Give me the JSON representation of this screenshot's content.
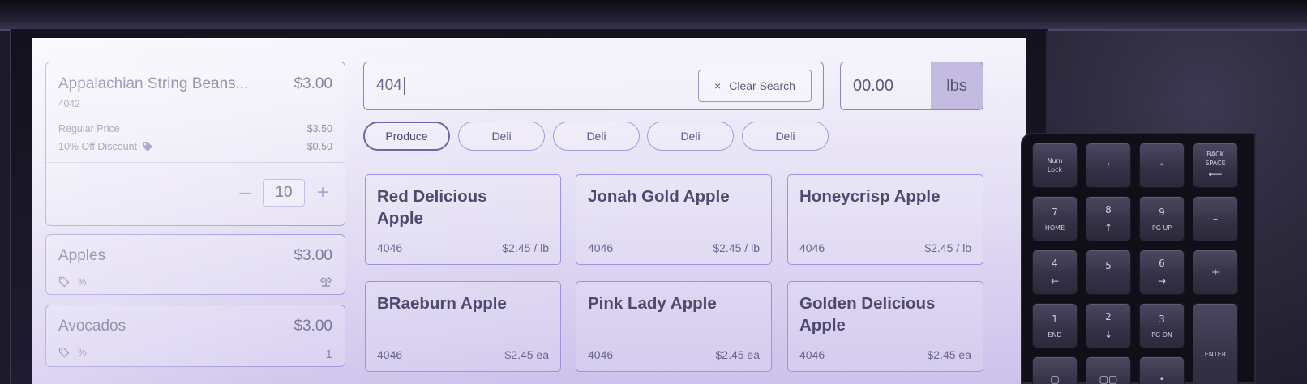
{
  "cart": {
    "items": [
      {
        "name": "Appalachian String Beans...",
        "price": "$3.00",
        "sku": "4042",
        "regular_label": "Regular Price",
        "regular_value": "$3.50",
        "discount_label": "10% Off Discount",
        "discount_value": "— $0.50",
        "qty": "10",
        "minus": "–",
        "plus": "+"
      },
      {
        "name": "Apples",
        "price": "$3.00"
      },
      {
        "name": "Avocados",
        "price": "$3.00",
        "qty": "1"
      }
    ],
    "pct_icon_text": "%"
  },
  "search": {
    "value": "404",
    "clear_label": "Clear Search",
    "clear_icon": "×"
  },
  "weight": {
    "value": "00.00",
    "unit": "lbs"
  },
  "categories": [
    "Produce",
    "Deli",
    "Deli",
    "Deli",
    "Deli"
  ],
  "products": [
    {
      "name": "Red Delicious Apple",
      "sku": "4046",
      "price": "$2.45 / lb"
    },
    {
      "name": "Jonah Gold Apple",
      "sku": "4046",
      "price": "$2.45 / lb"
    },
    {
      "name": "Honeycrisp Apple",
      "sku": "4046",
      "price": "$2.45 / lb"
    },
    {
      "name": "BRaeburn Apple",
      "sku": "4046",
      "price": "$2.45 ea"
    },
    {
      "name": "Pink Lady Apple",
      "sku": "4046",
      "price": "$2.45 ea"
    },
    {
      "name": "Golden Delicious Apple",
      "sku": "4046",
      "price": "$2.45 ea"
    }
  ],
  "keypad": {
    "numlock_1": "Num",
    "numlock_2": "Lock",
    "slash": "/",
    "star": "*",
    "back_1": "BACK",
    "back_2": "SPACE",
    "back_arrow": "⟵",
    "k7": "7",
    "home": "HOME",
    "k8": "8",
    "up": "↑",
    "k9": "9",
    "pgup": "PG UP",
    "minus": "–",
    "k4": "4",
    "left": "←",
    "k5": "5",
    "k6": "6",
    "right": "→",
    "plus": "+",
    "k1": "1",
    "end": "END",
    "k2": "2",
    "down": "↓",
    "k3": "3",
    "pgdn": "PG DN",
    "enter": "ENTER",
    "k0": "▢",
    "k00": "▢▢",
    "dot": "•"
  },
  "colors": {
    "accent": "#8d7ee0",
    "card_border": "#9d92d8",
    "text": "#4f496f"
  }
}
